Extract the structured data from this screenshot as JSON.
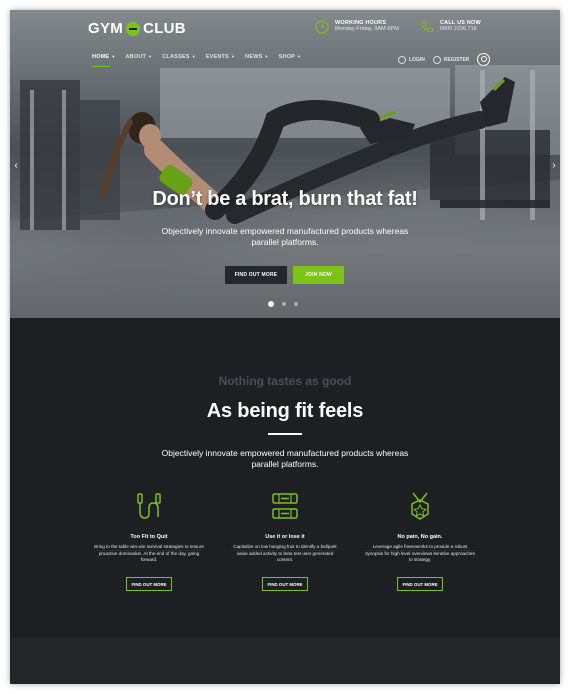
{
  "brand": {
    "logo_left": "GYM",
    "logo_right": "CLUB",
    "accent_color": "#7cc318"
  },
  "header": {
    "working_hours": {
      "title": "WORKING HOURS",
      "value": "Monday-Friday, 9AM-6PM",
      "icon": "clock-icon"
    },
    "call": {
      "title": "CALL US NOW",
      "value": "0800 2236 718",
      "icon": "phone-icon"
    },
    "nav": [
      {
        "label": "HOME"
      },
      {
        "label": "ABOUT"
      },
      {
        "label": "CLASSES"
      },
      {
        "label": "EVENTS"
      },
      {
        "label": "NEWS"
      },
      {
        "label": "SHOP"
      }
    ],
    "login_label": "LOGIN",
    "register_label": "REGISTER"
  },
  "hero": {
    "title": "Don’t be a brat, burn that fat!",
    "subtitle": "Objectively innovate empowered manufactured products whereas parallel platforms.",
    "primary_button": "FIND OUT MORE",
    "secondary_button": "JOIN NOW",
    "slide_count": 3,
    "active_slide": 1
  },
  "intro": {
    "tagline": "Nothing tastes as good",
    "title": "As being fit feels",
    "subtitle": "Objectively innovate empowered manufactured products whereas parallel platforms."
  },
  "features": [
    {
      "icon": "jump-rope-icon",
      "title": "Too Fit to Quit",
      "text": "Bring to the table win-win survival strategies to ensure proactive domination. At the end of the day, going forward.",
      "button": "FIND OUT MORE"
    },
    {
      "icon": "dumbbell-icon",
      "title": "Use it or lose it",
      "text": "Capitalize on low hanging fruit to identify a ballpark value added activity to beta test user generated content.",
      "button": "FIND OUT MORE"
    },
    {
      "icon": "medal-icon",
      "title": "No pain, No gain.",
      "text": "Leverage agile frameworks to provide a robust synopsis for high level overviews iterative approaches to strategy.",
      "button": "FIND OUT MORE"
    }
  ]
}
